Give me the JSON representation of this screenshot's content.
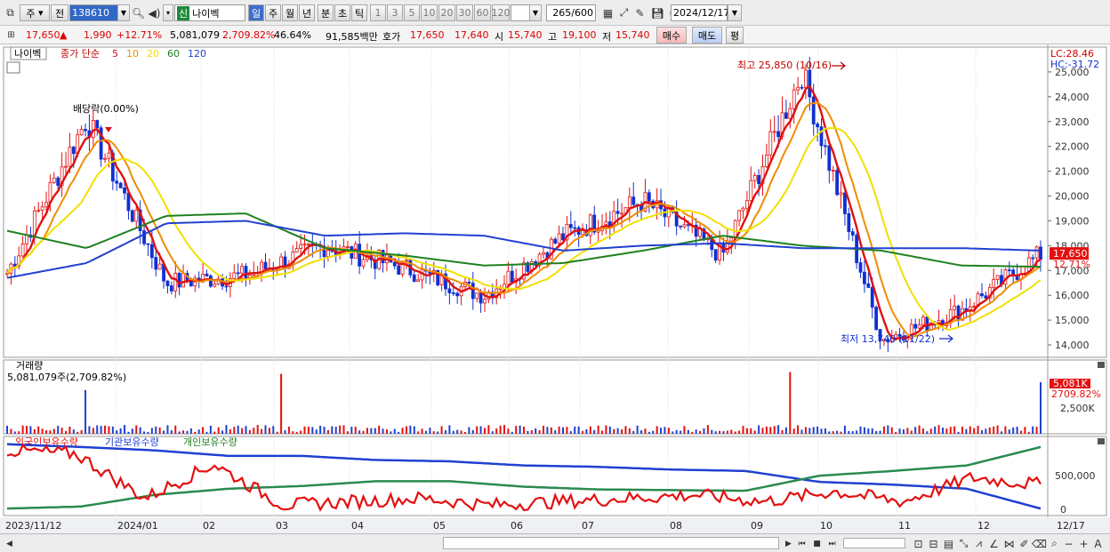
{
  "toolbar": {
    "type1": "주",
    "type2": "전",
    "code": "138610",
    "period_code": "신",
    "name": "나이벡",
    "periods": [
      "일",
      "주",
      "월",
      "년",
      "분",
      "초",
      "틱"
    ],
    "nums": [
      "1",
      "3",
      "5",
      "10",
      "20",
      "30",
      "60",
      "120"
    ],
    "count": "265",
    "count_max": "/600",
    "date": "2024/12/17"
  },
  "quote": {
    "price": "17,650",
    "arrow": "▲",
    "change": "1,990",
    "change_pct": "+12.71%",
    "volume": "5,081,079",
    "vol_pct": "2,709.82%",
    "turnover": "46.64%",
    "amount": "91,585백만",
    "hoga_label": "호가",
    "hoga_ask": "17,650",
    "hoga_bid": "17,640",
    "open_label": "시",
    "open": "15,740",
    "high_label": "고",
    "high": "19,100",
    "low_label": "저",
    "low": "15,740",
    "buy": "매수",
    "sell": "매도",
    "flat": "평"
  },
  "price_panel": {
    "name": "나이벡",
    "legend": "종가 단순",
    "ma": [
      "5",
      "10",
      "20",
      "60",
      "120"
    ],
    "ma_colors": [
      "#e01010",
      "#f08c00",
      "#f0e000",
      "#208020",
      "#2040d0"
    ],
    "lc": "LC:28.46",
    "hc": "HC:-31.72",
    "max_label": "최고 25,850 (10/16)",
    "min_label": "최저 13,740 (11/22)",
    "dividend": "배당락(0.00%)",
    "last_price": "17,650",
    "last_pct": "12.71%",
    "y_ticks": [
      "25,000",
      "24,000",
      "23,000",
      "22,000",
      "21,000",
      "20,000",
      "19,000",
      "18,000",
      "17,000",
      "16,000",
      "15,000",
      "14,000"
    ]
  },
  "volume_panel": {
    "title": "거래량",
    "value": "5,081,079주(2,709.82%)",
    "last": "5,081K",
    "last_pct": "2709.82%",
    "tick": "2,500K"
  },
  "holder_panel": {
    "s1": "외국인보유수량",
    "s2": "기관보유수량",
    "s3": "개인보유수량",
    "tick": "500,000",
    "tick0": "0"
  },
  "x_labels": [
    "2023/11/12",
    "2024/01",
    "02",
    "03",
    "04",
    "05",
    "06",
    "07",
    "08",
    "09",
    "10",
    "11",
    "12",
    "12/17"
  ],
  "chart_data": {
    "type": "line",
    "x": [
      "2023/11/12",
      "2024/01",
      "02",
      "03",
      "04",
      "05",
      "06",
      "07",
      "08",
      "09",
      "10",
      "11",
      "12",
      "12/17"
    ],
    "series": [
      {
        "name": "종가",
        "values": [
          16900,
          23100,
          16500,
          16800,
          18000,
          17100,
          16000,
          18400,
          19800,
          17600,
          25000,
          14200,
          15400,
          17650
        ]
      },
      {
        "name": "20",
        "values": [
          15300,
          21500,
          19000,
          16700,
          17300,
          16900,
          16300,
          17000,
          19200,
          18000,
          22000,
          15400,
          15200,
          15300
        ]
      },
      {
        "name": "60",
        "values": [
          18600,
          17900,
          19200,
          19300,
          17900,
          17600,
          17200,
          17300,
          17800,
          18400,
          18000,
          17800,
          17200,
          17150
        ]
      },
      {
        "name": "120",
        "values": [
          16700,
          17300,
          18900,
          19000,
          18400,
          18500,
          18400,
          17800,
          18000,
          18100,
          17900,
          17900,
          17900,
          17800
        ]
      }
    ],
    "ylim": [
      13500,
      26000
    ],
    "max": {
      "value": 25850,
      "date": "10/16"
    },
    "min": {
      "value": 13740,
      "date": "11/22"
    }
  }
}
